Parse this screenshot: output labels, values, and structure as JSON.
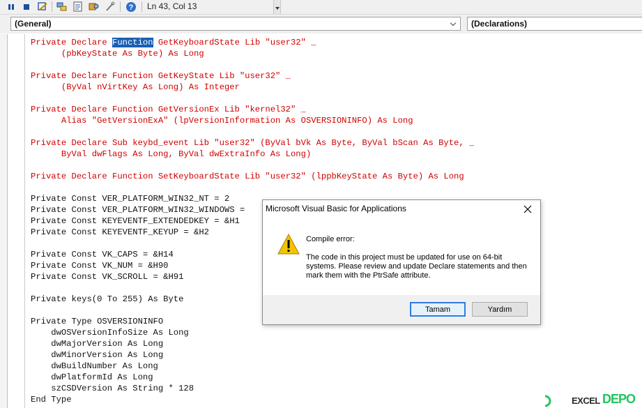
{
  "toolbar": {
    "status": "Ln 43, Col 13",
    "icons": [
      "pause-icon",
      "stop-icon",
      "design-mode-icon",
      "project-explorer-icon",
      "properties-icon",
      "object-browser-icon",
      "toolbox-icon",
      "help-icon"
    ]
  },
  "combos": {
    "object": "(General)",
    "procedure": "(Declarations)"
  },
  "code": {
    "lines": [
      {
        "pre": "Private Declare ",
        "sel": "Function",
        "post": " GetKeyboardState Lib \"user32\" _",
        "color": "red"
      },
      {
        "text": "      (pbKeyState As Byte) As Long",
        "color": "red"
      },
      {
        "text": "",
        "color": "red"
      },
      {
        "text": "Private Declare Function GetKeyState Lib \"user32\" _",
        "color": "red"
      },
      {
        "text": "      (ByVal nVirtKey As Long) As Integer",
        "color": "red"
      },
      {
        "text": "",
        "color": "red"
      },
      {
        "text": "Private Declare Function GetVersionEx Lib \"kernel32\" _",
        "color": "red"
      },
      {
        "text": "      Alias \"GetVersionExA\" (lpVersionInformation As OSVERSIONINFO) As Long",
        "color": "red"
      },
      {
        "text": "",
        "color": "red"
      },
      {
        "text": "Private Declare Sub keybd_event Lib \"user32\" (ByVal bVk As Byte, ByVal bScan As Byte, _",
        "color": "red"
      },
      {
        "text": "      ByVal dwFlags As Long, ByVal dwExtraInfo As Long)",
        "color": "red"
      },
      {
        "text": "",
        "color": "red"
      },
      {
        "text": "Private Declare Function SetKeyboardState Lib \"user32\" (lppbKeyState As Byte) As Long",
        "color": "red"
      },
      {
        "text": "",
        "color": "black"
      },
      {
        "text": "Private Const VER_PLATFORM_WIN32_NT = 2",
        "color": "black"
      },
      {
        "text": "Private Const VER_PLATFORM_WIN32_WINDOWS =",
        "color": "black"
      },
      {
        "text": "Private Const KEYEVENTF_EXTENDEDKEY = &H1",
        "color": "black"
      },
      {
        "text": "Private Const KEYEVENTF_KEYUP = &H2",
        "color": "black"
      },
      {
        "text": "",
        "color": "black"
      },
      {
        "text": "Private Const VK_CAPS = &H14",
        "color": "black"
      },
      {
        "text": "Private Const VK_NUM = &H90",
        "color": "black"
      },
      {
        "text": "Private Const VK_SCROLL = &H91",
        "color": "black"
      },
      {
        "text": "",
        "color": "black"
      },
      {
        "text": "Private keys(0 To 255) As Byte",
        "color": "black"
      },
      {
        "text": "",
        "color": "black"
      },
      {
        "text": "Private Type OSVERSIONINFO",
        "color": "black"
      },
      {
        "text": "    dwOSVersionInfoSize As Long",
        "color": "black"
      },
      {
        "text": "    dwMajorVersion As Long",
        "color": "black"
      },
      {
        "text": "    dwMinorVersion As Long",
        "color": "black"
      },
      {
        "text": "    dwBuildNumber As Long",
        "color": "black"
      },
      {
        "text": "    dwPlatformId As Long",
        "color": "black"
      },
      {
        "text": "    szCSDVersion As String * 128",
        "color": "black"
      },
      {
        "text": "End Type",
        "color": "black"
      }
    ],
    "colors": {
      "red": "#d10000",
      "black": "#111111",
      "selection": "#1a5fb4"
    }
  },
  "dialog": {
    "title": "Microsoft Visual Basic for Applications",
    "heading": "Compile error:",
    "message": "The code in this project must be updated for use on 64-bit systems.  Please review and update Declare statements and then mark them with the PtrSafe attribute.",
    "ok_label": "Tamam",
    "help_label": "Yardım",
    "icon": "warning-icon"
  },
  "watermark": {
    "text": "EXCEL",
    "brand": "DEPO",
    "brand_color": "#22c55e"
  }
}
